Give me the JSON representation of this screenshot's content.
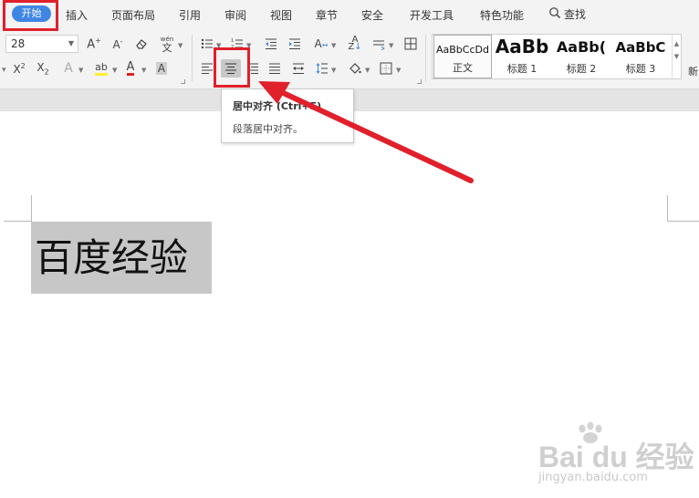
{
  "menu": {
    "tabs": [
      {
        "label": "开始",
        "active": true
      },
      {
        "label": "插入"
      },
      {
        "label": "页面布局"
      },
      {
        "label": "引用"
      },
      {
        "label": "审阅"
      },
      {
        "label": "视图"
      },
      {
        "label": "章节"
      },
      {
        "label": "安全"
      },
      {
        "label": "开发工具"
      },
      {
        "label": "特色功能"
      }
    ],
    "search_label": "查找"
  },
  "ribbon": {
    "font_size": "28",
    "phonetic_glyph": "wén",
    "new_style_label": "新",
    "styles": [
      {
        "sample": "AaBbCcDd",
        "label": "正文"
      },
      {
        "sample": "AaBb",
        "label": "标题 1"
      },
      {
        "sample": "AaBb(",
        "label": "标题 2"
      },
      {
        "sample": "AaBbC",
        "label": "标题 3"
      }
    ]
  },
  "tooltip": {
    "title": "居中对齐 (Ctrl+E)",
    "description": "段落居中对齐。"
  },
  "document": {
    "selected_text": "百度经验"
  },
  "watermark": {
    "logo": "Bai du 经验",
    "url": "jingyan.baidu.com"
  },
  "colors": {
    "accent": "#3f86e4",
    "annotation_red": "#e0202b",
    "selection_bg": "#c7c7c7"
  }
}
